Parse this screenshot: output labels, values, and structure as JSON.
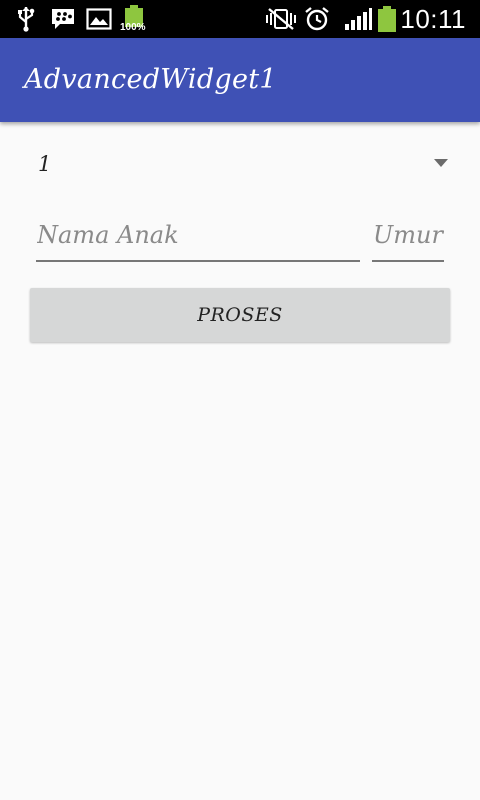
{
  "status_bar": {
    "time": "10:11",
    "battery_percent": "100%",
    "icons": [
      "usb-icon",
      "bbm-icon",
      "gallery-icon",
      "battery-charging-icon",
      "vibrate-icon",
      "alarm-icon",
      "signal-icon",
      "battery-icon"
    ]
  },
  "app_bar": {
    "title": "AdvancedWidget1",
    "color": "#3f51b5"
  },
  "form": {
    "spinner_value": "1",
    "name_placeholder": "Nama Anak",
    "age_placeholder": "Umur",
    "submit_label": "PROSES"
  },
  "colors": {
    "background": "#fafafa",
    "button": "#d6d7d7",
    "battery_green": "#8ec63f"
  }
}
